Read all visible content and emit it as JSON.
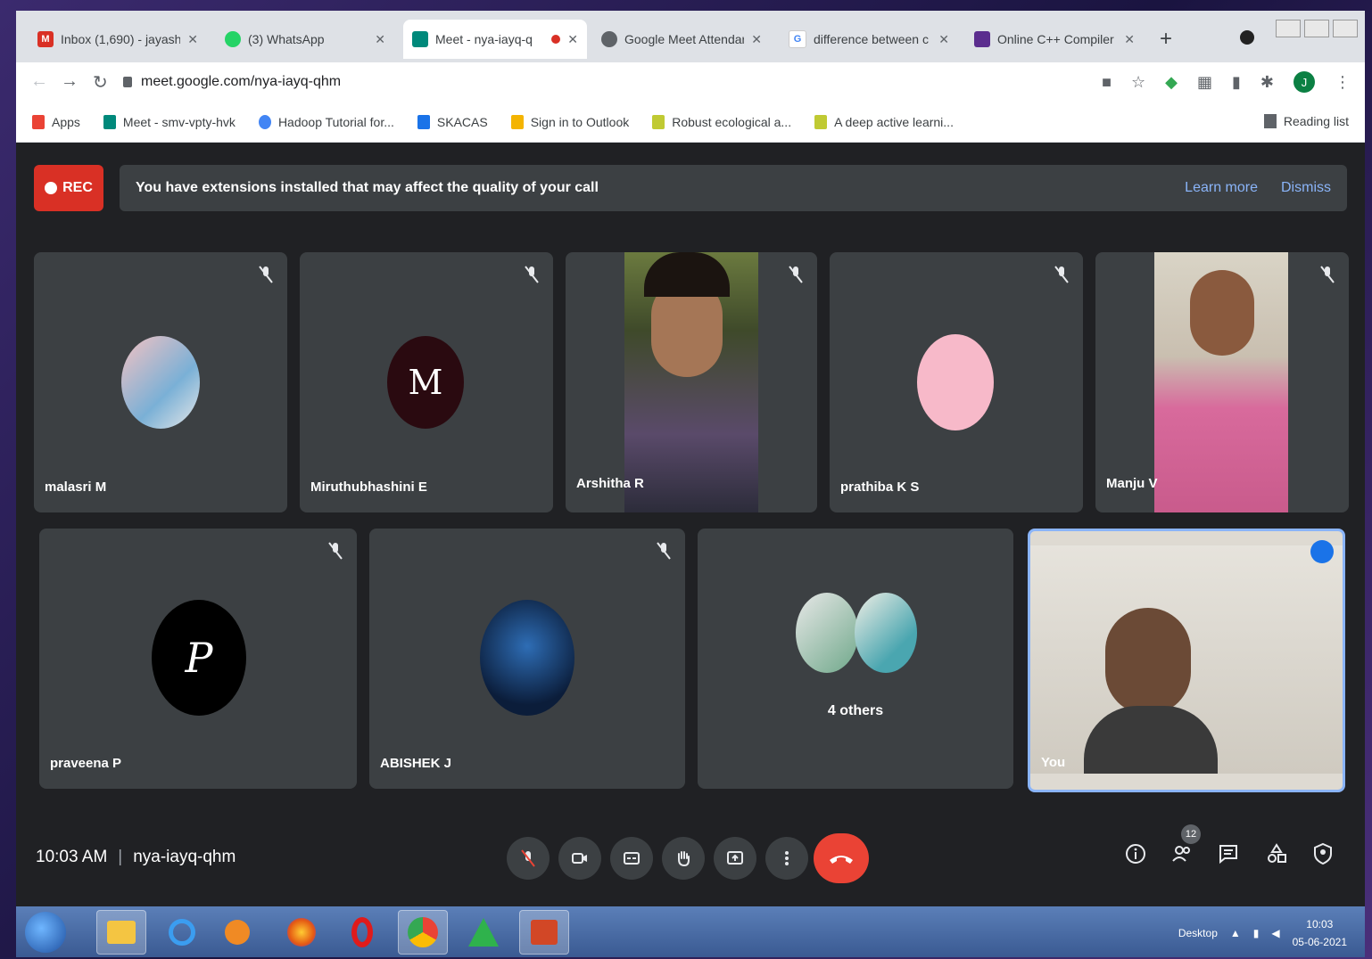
{
  "browser": {
    "tabs": [
      {
        "title": "Inbox (1,690) - jayashe",
        "favicon": "gmail-icon",
        "color": "#d93025"
      },
      {
        "title": "(3) WhatsApp",
        "favicon": "whatsapp-icon",
        "color": "#25d366"
      },
      {
        "title": "Meet - nya-iayq-q",
        "favicon": "meet-icon",
        "color": "#00897b"
      },
      {
        "title": "Google Meet Attendar",
        "favicon": "chrome-ext-icon",
        "color": "#5f6368"
      },
      {
        "title": "difference between c",
        "favicon": "google-icon",
        "color": "#4285f4"
      },
      {
        "title": "Online C++ Compiler",
        "favicon": "compiler-icon",
        "color": "#5b2d8e"
      }
    ],
    "new_tab": "+",
    "url": "meet.google.com/nya-iayq-qhm",
    "profile_initial": "J",
    "bookmarks": [
      {
        "label": "Apps",
        "color": "#ea4335"
      },
      {
        "label": "Meet - smv-vpty-hvk",
        "color": "#00897b"
      },
      {
        "label": "Hadoop Tutorial for...",
        "color": "#4285f4"
      },
      {
        "label": "SKACAS",
        "color": "#1a73e8"
      },
      {
        "label": "Sign in to Outlook",
        "color": "#f4b400"
      },
      {
        "label": "Robust ecological a...",
        "color": "#c0ca33"
      },
      {
        "label": "A deep active learni...",
        "color": "#c0ca33"
      }
    ],
    "reading_list": "Reading list"
  },
  "meet": {
    "rec_label": "REC",
    "banner_message": "You have extensions installed that may affect the quality of your call",
    "learn_more": "Learn more",
    "dismiss": "Dismiss",
    "participants": [
      {
        "name": "malasri M"
      },
      {
        "name": "Miruthubhashini E",
        "initial": "M"
      },
      {
        "name": "Arshitha R"
      },
      {
        "name": "prathiba K S"
      },
      {
        "name": "Manju V"
      },
      {
        "name": "praveena P",
        "initial": "P"
      },
      {
        "name": "ABISHEK J"
      },
      {
        "name": "4 others"
      },
      {
        "name": "You"
      }
    ],
    "time": "10:03 AM",
    "meeting_code": "nya-iayq-qhm",
    "participant_count": "12",
    "accent": "#8ab4f8",
    "hangup_color": "#ea4335"
  },
  "taskbar": {
    "desktop_label": "Desktop",
    "clock_time": "10:03",
    "clock_date": "05-06-2021"
  }
}
